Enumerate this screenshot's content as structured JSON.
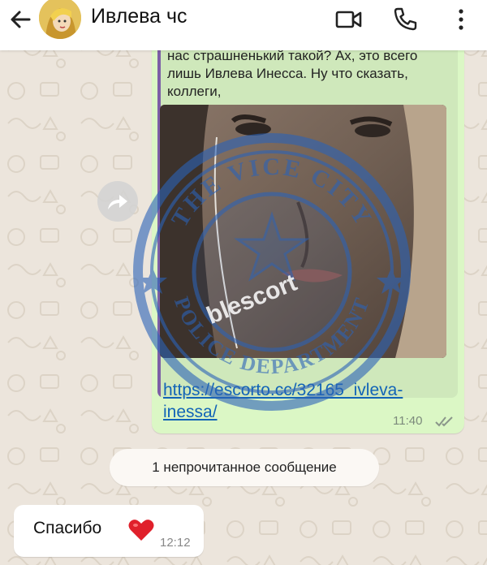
{
  "header": {
    "contact_name": "Ивлева чс",
    "back_icon": "arrow-left-icon",
    "video_icon": "video-call-icon",
    "phone_icon": "phone-icon",
    "menu_icon": "more-vert-icon"
  },
  "messages": {
    "forwarded": {
      "quote_text": "нас страшненький такой? Ах, это всего лишь Ивлева Инесса. Ну что сказать, коллеги,",
      "link_text": "https://escorto.cc/32165_ivleva-inessa/",
      "time": "11:40",
      "status": "read"
    },
    "unread_banner": "1 непрочитанное сообщение",
    "incoming": {
      "text": "Спасибо",
      "emoji": "heart-icon",
      "time": "12:12"
    }
  },
  "watermark": {
    "seal_top": "THE VICE CITY",
    "seal_bottom": "POLICE DEPARTMENT",
    "brand": "blescort"
  },
  "colors": {
    "outgoing_bubble": "#dbf7c5",
    "link": "#1264b7",
    "quote_bar": "#7c5fa6",
    "heart": "#e0202b",
    "seal_blue": "#2b63b8"
  }
}
